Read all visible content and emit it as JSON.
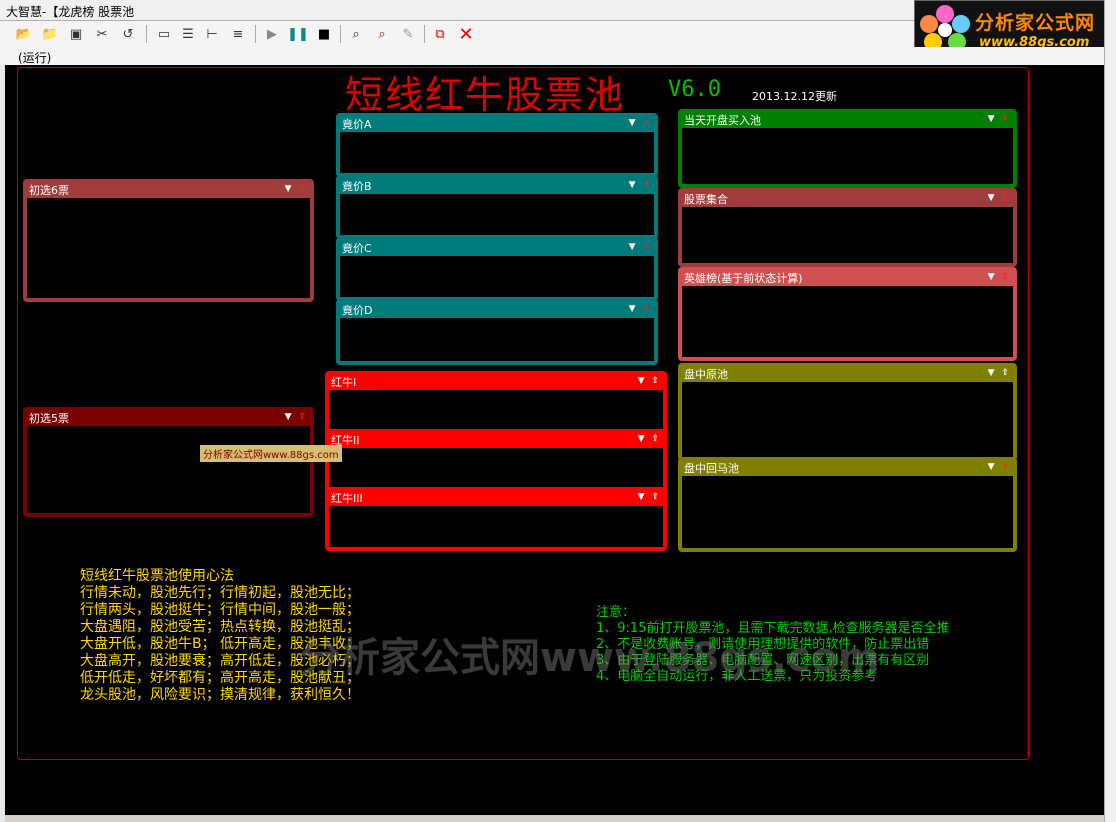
{
  "window": {
    "title": "大智慧-【龙虎榜 股票池"
  },
  "status": {
    "text": "(运行)"
  },
  "logo": {
    "text": "分析家公式网",
    "url": "www.88gs.com"
  },
  "header": {
    "title": "短线红牛股票池",
    "version": "V6.0",
    "date": "2013.12.12更新"
  },
  "panels": {
    "chuxuan6": "初选6票",
    "chuxuan5": "初选5票",
    "jingjia_a": "竟价A",
    "jingjia_b": "竟价B",
    "jingjia_c": "竟价C",
    "jingjia_d": "竟价D",
    "hongniu1": "红牛I",
    "hongniu2": "红牛II",
    "hongniu3": "红牛III",
    "dangtian": "当天开盘买入池",
    "gupiao_jihe": "股票集合",
    "yingxiong": "英雄榜(基于前状态计算)",
    "panzhong_yuan": "盘中原池",
    "panzhong_huima": "盘中回马池"
  },
  "watermark": {
    "small": "分析家公式网www.88gs.com",
    "big": "分析家公式网www.88gs.com"
  },
  "tips": {
    "title": "短线红牛股票池使用心法",
    "lines": [
      "行情未动，股池先行；行情初起，股池无比；",
      "行情两头，股池挺牛；行情中间，股池一般；",
      "大盘遇阻，股池受苦；热点转换，股池挺乱；",
      "大盘开低，股池牛B；  低开高走，股池丰收；",
      "大盘高开，股池要衰；高开低走，股池必朽；",
      "低开低走，好坏都有；高开高走，股池献丑；",
      "龙头股池，风险要识；摸清规律，获利恒久！"
    ]
  },
  "notes": {
    "title": "注意：",
    "lines": [
      "1、9:15前打开股票池，且需下载完数据,检查服务器是否全推",
      "2、不是收费账号，则请使用理想提供的软件，防止票出错",
      "3、由于登陆服务器、电脑配置、网速区别，出票有有区别",
      "4、电脑全自动运行，非人工送票，只为投资参考"
    ]
  },
  "colors": {
    "teal": "#007a7a",
    "brownred": "#a03c3c",
    "darkred": "#7a0000",
    "red": "#ff0000",
    "green": "#008000",
    "salmon": "#d05050",
    "olive": "#808000"
  }
}
